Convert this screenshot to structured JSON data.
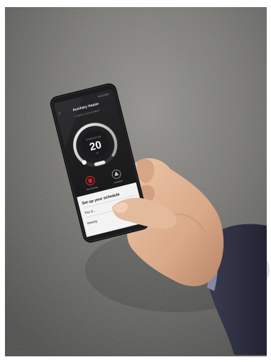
{
  "photo": {
    "colors": {
      "frame": "#ffffff",
      "carpet_light": "#8f8f8b",
      "carpet_dark": "#4a4a48",
      "phone_body": "#121213",
      "screen_bg": "#1c1c1e",
      "panel_white": "#f2f2f2",
      "accent_red": "#d0252b",
      "skin": "#e2b99a",
      "sleeve": "#2c2d3f"
    }
  },
  "app": {
    "title": "Auxiliary Heater",
    "subtitle": "CLIMATE & ADJUSTMENT",
    "temperature": "20",
    "temp_label": "TEMPERATURE",
    "temp_unit": "°C",
    "action_left_label": "Start Heating",
    "action_right_label": "Ventilation",
    "schedule_title": "Set up your schedule",
    "schedule_item_1": "The D…",
    "schedule_item_2": "Weekly"
  },
  "status_bar": {
    "time": "4:5 12:00"
  }
}
